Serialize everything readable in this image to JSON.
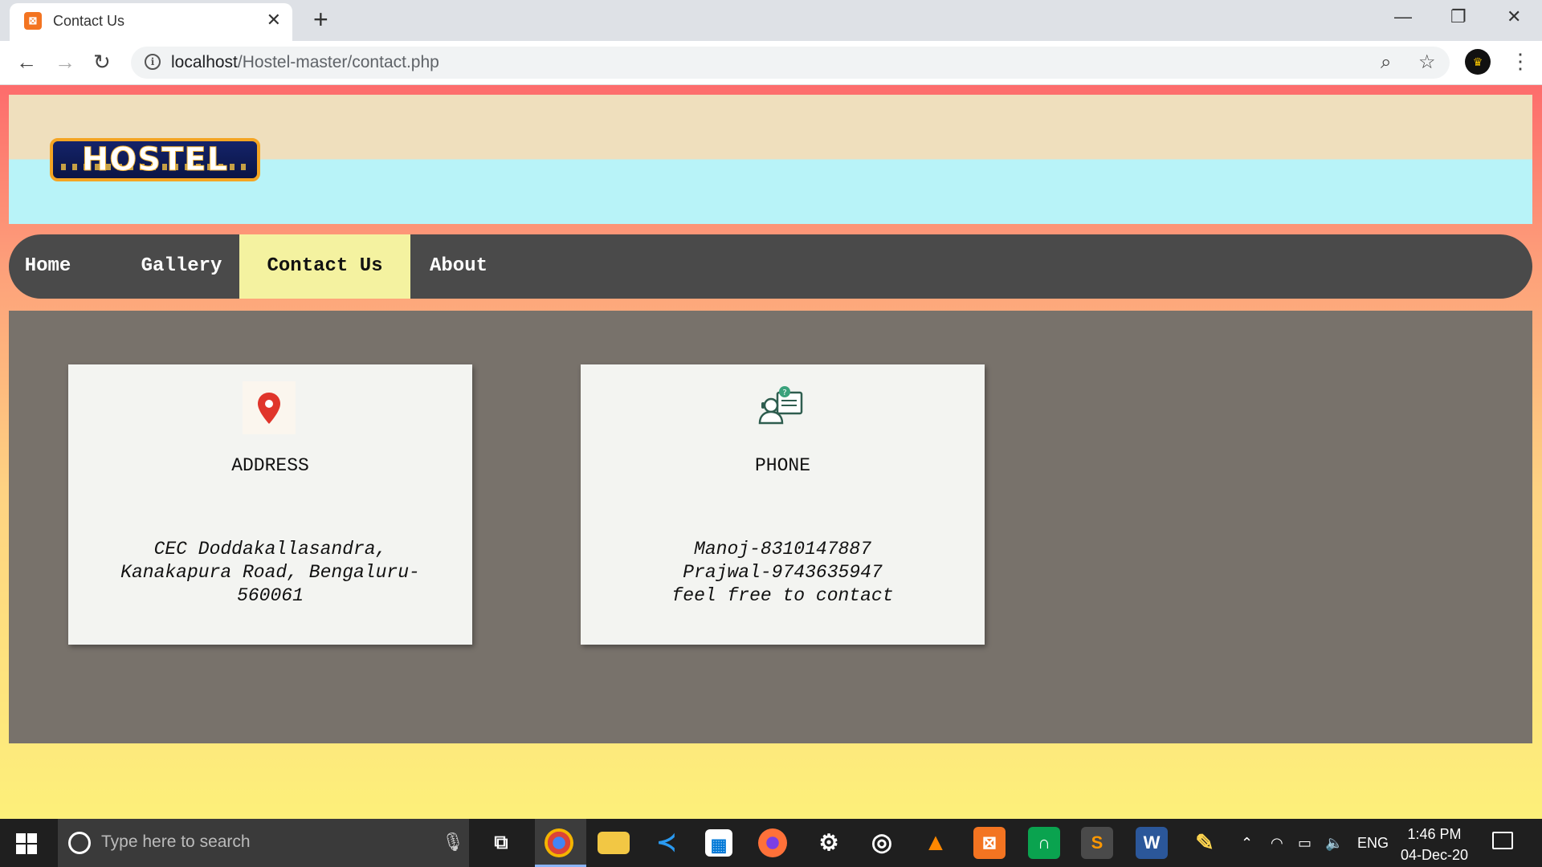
{
  "browser": {
    "tab_title": "Contact Us",
    "url_host": "localhost",
    "url_path": "/Hostel-master/contact.php"
  },
  "site": {
    "logo_text": "HOSTEL",
    "nav": [
      {
        "label": "Home",
        "active": false
      },
      {
        "label": "Gallery",
        "active": false
      },
      {
        "label": "Contact Us",
        "active": true
      },
      {
        "label": "About",
        "active": false
      }
    ]
  },
  "cards": [
    {
      "icon": "location-pin-icon",
      "heading": "ADDRESS",
      "lines": [
        "CEC Doddakallasandra,",
        "Kanakapura Road, Bengaluru-",
        "560061"
      ]
    },
    {
      "icon": "support-agent-icon",
      "heading": "PHONE",
      "lines": [
        "Manoj-8310147887",
        "Prajwal-9743635947",
        "feel free to contact"
      ]
    }
  ],
  "taskbar": {
    "search_placeholder": "Type here to search",
    "language": "ENG",
    "time": "1:46 PM",
    "date": "04-Dec-20"
  },
  "colors": {
    "nav_bg": "#4a4a4a",
    "nav_active_bg": "#f4f2a0",
    "content_bg": "#78726b",
    "card_bg": "#f3f4f1",
    "pin_red": "#e0352b"
  }
}
